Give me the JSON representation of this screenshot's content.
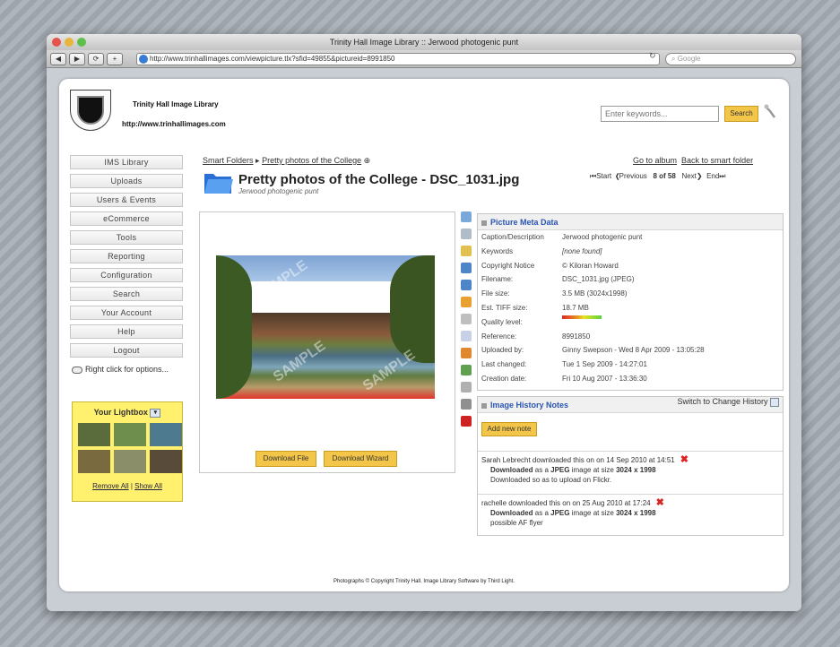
{
  "browser": {
    "title": "Trinity Hall Image Library :: Jerwood photogenic punt",
    "url": "http://www.trinhallimages.com/viewpicture.tlx?sfid=49855&pictureid=8991850",
    "search_placeholder": "Google"
  },
  "site": {
    "name": "Trinity Hall Image Library",
    "url": "http://www.trinhallimages.com",
    "search_placeholder": "Enter keywords...",
    "search_button": "Search"
  },
  "nav": [
    "IMS Library",
    "Uploads",
    "Users & Events",
    "eCommerce",
    "Tools",
    "Reporting",
    "Configuration",
    "Search",
    "Your Account",
    "Help",
    "Logout"
  ],
  "right_click_tip": "Right click for options...",
  "lightbox": {
    "title": "Your Lightbox",
    "remove_all": "Remove All",
    "separator": "|",
    "show_all": "Show All",
    "thumb_colors": [
      "#5a6b3c",
      "#6e8e4e",
      "#4d7a8f",
      "#7a6a3f",
      "#8a8f6a",
      "#584b3a"
    ]
  },
  "breadcrumb": {
    "smart_folders": "Smart Folders",
    "sep": "▸",
    "folder": "Pretty photos of the College",
    "info": "⊕"
  },
  "album_links": {
    "go_to_album": "Go to album",
    "back": "Back to smart folder"
  },
  "picture": {
    "title": "Pretty photos of the College - DSC_1031.jpg",
    "subtitle": "Jerwood photogenic punt"
  },
  "pager": {
    "start": "Start",
    "previous": "Previous",
    "position": "8 of 58",
    "next": "Next",
    "end": "End"
  },
  "downloads": {
    "file": "Download File",
    "wizard": "Download Wizard"
  },
  "watermark": "SAMPLE",
  "meta": {
    "title": "Picture Meta Data",
    "rows": [
      [
        "Caption/Description",
        "Jerwood photogenic punt"
      ],
      [
        "Keywords",
        "[none found]"
      ],
      [
        "Copyright Notice",
        "© Kiloran Howard"
      ],
      [
        "Filename:",
        "DSC_1031.jpg (JPEG)"
      ],
      [
        "File size:",
        "3.5 MB (3024x1998)"
      ],
      [
        "Est. TIFF size:",
        "18.7 MB"
      ],
      [
        "Quality level:",
        ""
      ],
      [
        "Reference:",
        "8991850"
      ],
      [
        "Uploaded by:",
        "Ginny Swepson - Wed 8 Apr 2009 - 13:05:28"
      ],
      [
        "Last changed:",
        "Tue 1 Sep 2009 - 14:27:01"
      ],
      [
        "Creation date:",
        "Fri 10 Aug 2007 - 13:36:30"
      ]
    ]
  },
  "history": {
    "title": "Image History Notes",
    "switch": "Switch to Change History",
    "add_note": "Add new note",
    "notes": [
      {
        "header": "Sarah Lebrecht downloaded this on on 14 Sep 2010 at 14:51",
        "line1_bold": "Downloaded",
        "line1_mid": " as a ",
        "line1_fmt": "JPEG",
        "line1_size_pre": " image at size ",
        "line1_size": "3024 x 1998",
        "line2": "Downloaded so as to upload on Flickr."
      },
      {
        "header": "rachelle downloaded this on on 25 Aug 2010 at 17:24",
        "line1_bold": "Downloaded",
        "line1_mid": " as a ",
        "line1_fmt": "JPEG",
        "line1_size_pre": " image at size ",
        "line1_size": "3024 x 1998",
        "line2": "possible AF flyer"
      }
    ]
  },
  "footer": "Photographs © Copyright Trinity Hall. Image Library Software by Third Light.",
  "tools": [
    "#7aa8d8",
    "#b0bcc8",
    "#e0c050",
    "#4c86c8",
    "#4c86c8",
    "#e8a030",
    "#bfbfbf",
    "#c8d0e8",
    "#e08830",
    "#60a050",
    "#b0b0b0",
    "#909090",
    "#cc2222"
  ]
}
